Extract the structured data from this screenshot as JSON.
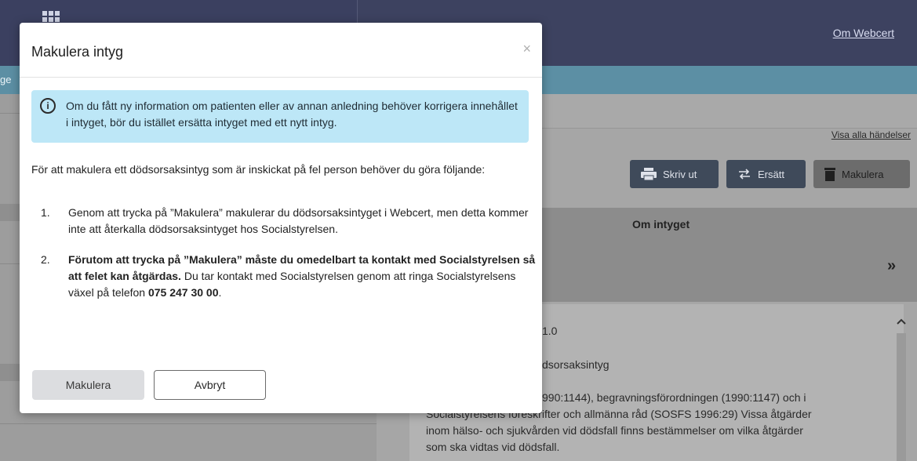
{
  "header": {
    "about_link": "Om Webcert",
    "left_fragment": "ge"
  },
  "events": {
    "link": "Visa alla händelser"
  },
  "toolbar": {
    "print_label": "Skriv ut",
    "replace_label": "Ersätt",
    "cancel_label": "Makulera"
  },
  "about_panel": {
    "title": "Om intyget",
    "expand_glyph": "»",
    "lines": [
      "1.0",
      "dsorsaksintyg",
      "990:1144), begravningsförordningen (1990:1147) och i",
      "Socialstyrelsens föreskrifter och allmänna råd (SOSFS 1996:29) Vissa åtgärder",
      "inom hälso- och sjukvården vid dödsfall finns bestämmelser om vilka åtgärder",
      "som ska vidtas vid dödsfall."
    ]
  },
  "modal": {
    "title": "Makulera intyg",
    "close_glyph": "×",
    "alert_icon_glyph": "i",
    "alert_text": "Om du fått ny information om patienten eller av annan anledning behöver korrigera innehållet i intyget, bör du istället ersätta intyget med ett nytt intyg.",
    "intro": "För att makulera ett dödsorsaksintyg som är inskickat på fel person behöver du göra följande:",
    "steps": [
      {
        "num": "1.",
        "text": "Genom att trycka på ”Makulera” makulerar du dödsorsaksintyget i Webcert, men detta kommer inte att återkalla dödsorsaksintyget hos Socialstyrelsen."
      },
      {
        "num": "2.",
        "bold": "Förutom att trycka på ”Makulera” måste du omedelbart ta kontakt med Socialstyrelsen så att felet kan åtgärdas.",
        "text": " Du tar kontakt med Socialstyrelsen genom att ringa Socialstyrelsens växel på telefon ",
        "phone": "075 247 30 00",
        "end": "."
      }
    ],
    "confirm_label": "Makulera",
    "cancel_label": "Avbryt"
  }
}
